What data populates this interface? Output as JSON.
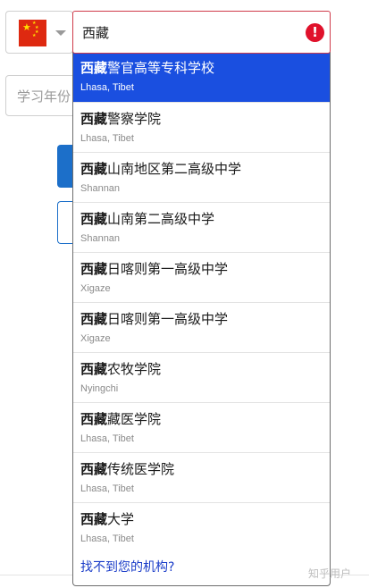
{
  "search": {
    "value": "西藏",
    "error_icon": "!"
  },
  "country": {
    "flag_name": "china-flag",
    "flag_red": "#de2910",
    "flag_yellow": "#ffde00"
  },
  "form": {
    "year_placeholder": "学习年份"
  },
  "dropdown": {
    "match": "西藏",
    "options": [
      {
        "rest": "警官高等专科学校",
        "location": "Lhasa, Tibet",
        "selected": true
      },
      {
        "rest": "警察学院",
        "location": "Lhasa, Tibet"
      },
      {
        "rest": "山南地区第二高级中学",
        "location": "Shannan"
      },
      {
        "rest": "山南第二高级中学",
        "location": "Shannan"
      },
      {
        "rest": "日喀则第一高级中学",
        "location": "Xigaze"
      },
      {
        "rest": "日喀则第一高级中学",
        "location": "Xigaze"
      },
      {
        "rest": "农牧学院",
        "location": "Nyingchi"
      },
      {
        "rest": "藏医学院",
        "location": "Lhasa, Tibet"
      },
      {
        "rest": "传统医学院",
        "location": "Lhasa, Tibet"
      },
      {
        "rest": "大学",
        "location": "Lhasa, Tibet"
      }
    ],
    "not_found_link": "找不到您的机构?"
  },
  "watermark": "知乎用户",
  "colors": {
    "selected_bg": "#1a4fe0",
    "error": "#e0112b",
    "link": "#1a3cc8",
    "primary_button": "#1c6fc9"
  }
}
